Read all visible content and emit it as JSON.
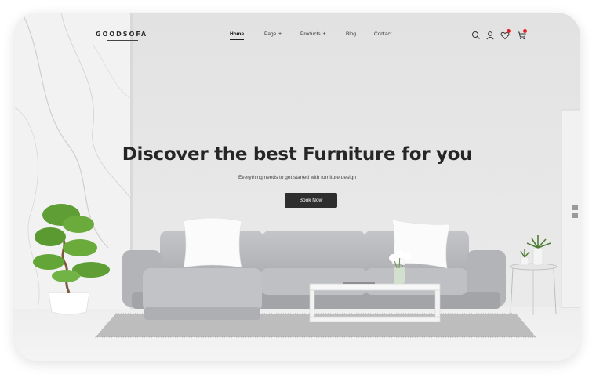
{
  "brand": {
    "logo": "GOODSOFA"
  },
  "nav": {
    "items": [
      {
        "label": "Home",
        "active": true,
        "has_submenu": false
      },
      {
        "label": "Page",
        "active": false,
        "has_submenu": true
      },
      {
        "label": "Products",
        "active": false,
        "has_submenu": true
      },
      {
        "label": "Blog",
        "active": false,
        "has_submenu": false
      },
      {
        "label": "Contact",
        "active": false,
        "has_submenu": false
      }
    ],
    "submenu_glyph": "+"
  },
  "header_icons": [
    {
      "name": "search-icon"
    },
    {
      "name": "user-icon"
    },
    {
      "name": "heart-icon",
      "badge": true
    },
    {
      "name": "cart-icon",
      "badge": true
    }
  ],
  "hero": {
    "title": "Discover the best Furniture for you",
    "subtitle": "Everything needs to get started with furniture design",
    "cta_label": "Book Now"
  },
  "colors": {
    "background_wall": "#e6e6e6",
    "cta_bg": "#2e2e2e",
    "badge": "#e32121",
    "text_dark": "#262626",
    "sofa": "#b9babd",
    "plant_green": "#6aab3c"
  }
}
